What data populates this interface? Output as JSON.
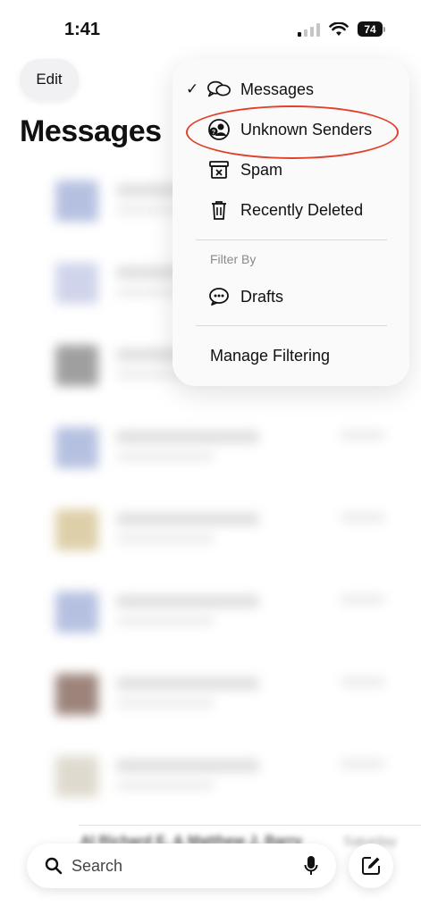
{
  "status_bar": {
    "time": "1:41",
    "battery": "74"
  },
  "header": {
    "edit_label": "Edit",
    "title": "Messages"
  },
  "menu": {
    "items": [
      {
        "label": "Messages",
        "icon": "chat-bubbles-icon",
        "checked": true
      },
      {
        "label": "Unknown Senders",
        "icon": "unknown-person-icon",
        "checked": false
      },
      {
        "label": "Spam",
        "icon": "spam-box-icon",
        "checked": false
      },
      {
        "label": "Recently Deleted",
        "icon": "trash-icon",
        "checked": false
      }
    ],
    "section_label": "Filter By",
    "filter_items": [
      {
        "label": "Drafts",
        "icon": "ellipsis-bubble-icon"
      }
    ],
    "manage_label": "Manage Filtering"
  },
  "background_row": {
    "title": "Al Richard E. & Matthew J. Barry",
    "date": "Saturday"
  },
  "bottom": {
    "search_label": "Search"
  },
  "colors": {
    "highlight": "#e0412c"
  }
}
